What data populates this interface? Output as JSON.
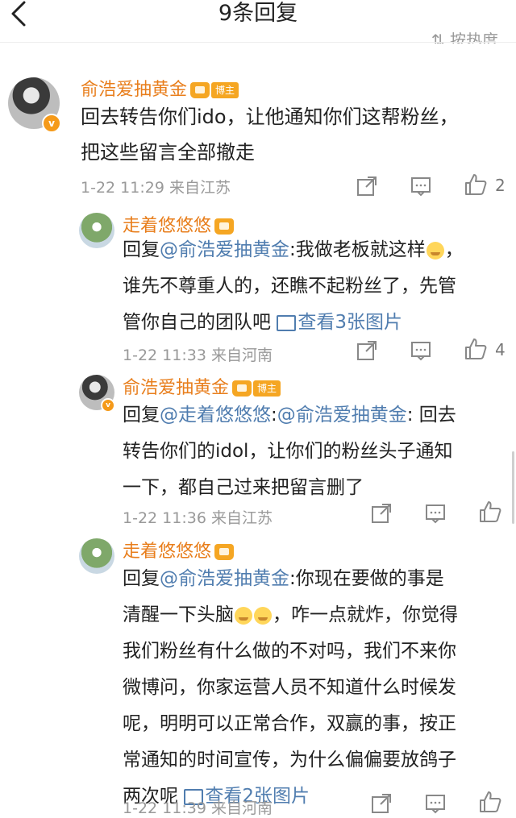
{
  "header": {
    "title": "9条回复",
    "sort_label": "按热度"
  },
  "comments": [
    {
      "author": "俞浩爱抽黄金",
      "badge": "博主",
      "lines": [
        "回去转告你们ido，让他通知你们这帮粉丝，",
        "把这些留言全部撤走"
      ],
      "time": "1-22 11:29",
      "location": "来自江苏",
      "likes": "2"
    },
    {
      "author": "走着悠悠悠",
      "reply_prefix": "回复",
      "reply_to": "@俞浩爱抽黄金",
      "first_text": ":我做老板就这样",
      "line2": "谁先不尊重人的，还瞧不起粉丝了，先管",
      "line3": "管你自己的团队吧",
      "pics": "查看3张图片",
      "time": "1-22 11:33",
      "location": "来自河南",
      "likes": "4"
    },
    {
      "author": "俞浩爱抽黄金",
      "badge": "博主",
      "reply_prefix": "回复",
      "reply_to": "@走着悠悠悠",
      "sep": ":",
      "mention": "@俞浩爱抽黄金",
      "first_text": ": 回去",
      "line2": "转告你们的idol，让你们的粉丝头子通知",
      "line3": "一下，都自己过来把留言删了",
      "time": "1-22 11:36",
      "location": "来自江苏"
    },
    {
      "author": "走着悠悠悠",
      "reply_prefix": "回复",
      "reply_to": "@俞浩爱抽黄金",
      "first_text": ":你现在要做的事是",
      "line2a": "清醒一下头脑",
      "line2b": "，咋一点就炸，你觉得",
      "line3": "我们粉丝有什么做的不对吗，我们不来你",
      "line4": "微博问，你家运营人员不知道什么时候发",
      "line5": "呢，明明可以正常合作，双赢的事，按正",
      "line6": "常通知的时间宣传，为什么偏偏要放鸽子",
      "line7": "两次呢",
      "pics": "查看2张图片",
      "time": "1-22 11:39",
      "location": "来自河南"
    }
  ],
  "icons": {
    "back": "chevron-left-icon",
    "share": "share-icon",
    "comment": "comment-icon",
    "like": "thumbs-up-icon"
  },
  "colors": {
    "author": "#e87e1c",
    "link": "#507daf",
    "meta": "#999999"
  }
}
